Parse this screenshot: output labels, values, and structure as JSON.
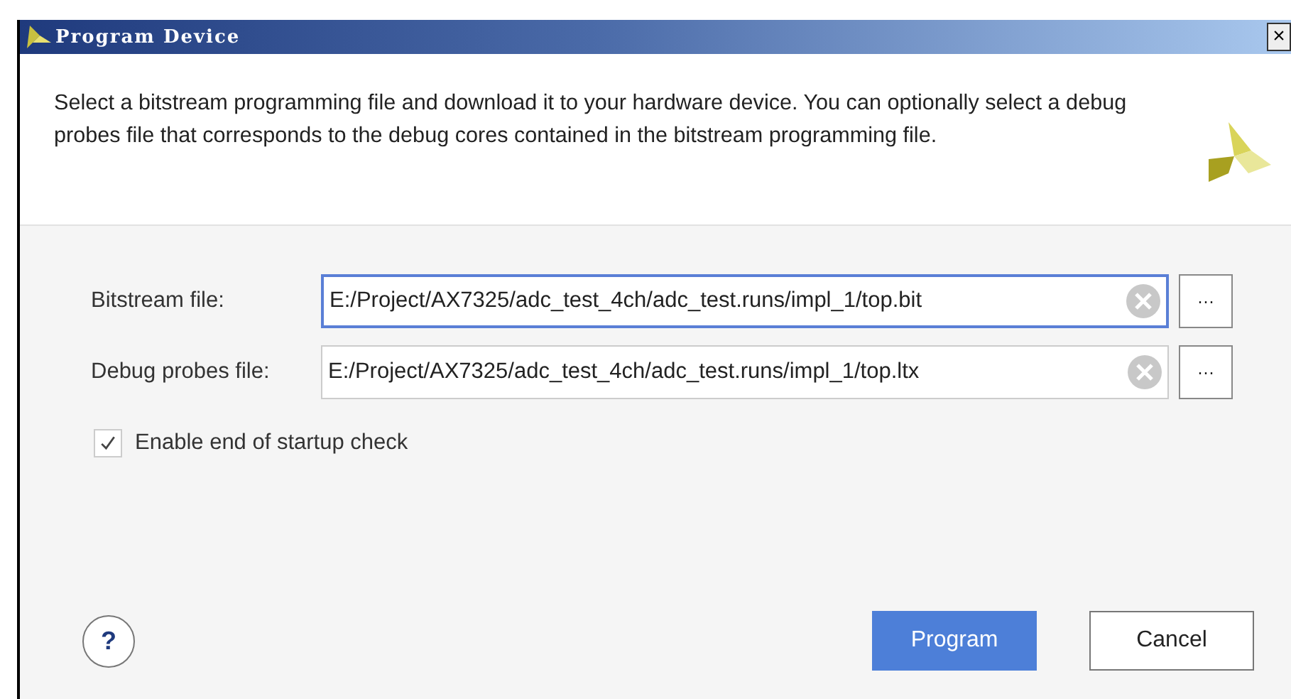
{
  "window": {
    "title": "Program Device",
    "close": "×"
  },
  "description": "Select a bitstream programming file and download it to your hardware device. You can optionally select a debug probes file that corresponds to the debug cores contained in the bitstream programming file.",
  "fields": [
    {
      "label": "Bitstream file:",
      "value": "E:/Project/AX7325/adc_test_4ch/adc_test.runs/impl_1/top.bit",
      "focused": true,
      "browse": "···"
    },
    {
      "label": "Debug probes file:",
      "value": "E:/Project/AX7325/adc_test_4ch/adc_test.runs/impl_1/top.ltx",
      "focused": false,
      "browse": "···"
    }
  ],
  "checkbox": {
    "label": "Enable end of startup check",
    "checked": true
  },
  "help": "?",
  "buttons": [
    {
      "label": "Program",
      "kind": "primary"
    },
    {
      "label": "Cancel",
      "kind": "secondary"
    }
  ]
}
